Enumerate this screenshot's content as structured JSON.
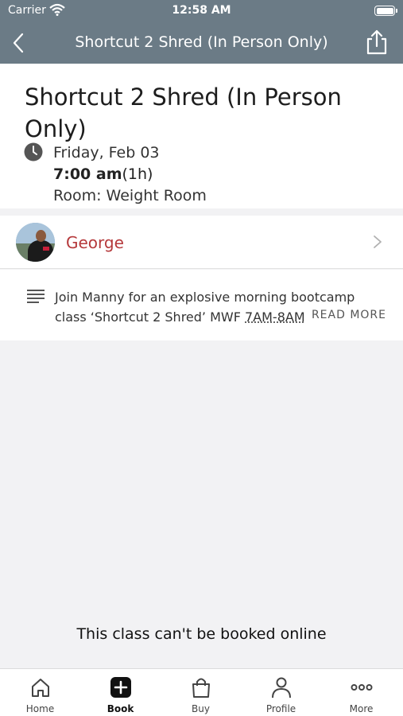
{
  "status_bar": {
    "carrier": "Carrier",
    "time": "12:58 AM"
  },
  "nav": {
    "title": "Shortcut 2 Shred (In Person Only)",
    "back_icon": "chevron-left-icon",
    "share_icon": "share-icon"
  },
  "class": {
    "title": "Shortcut 2 Shred (In Person Only)",
    "date": "Friday, Feb 03",
    "start_time": "7:00 am",
    "duration": "(1h)",
    "room": "Room: Weight Room"
  },
  "instructor": {
    "name": "George"
  },
  "description": {
    "text": "Join Manny for an explosive morning bootcamp class ‘Shortcut 2 Shred’ MWF ",
    "hours": "7AM-8AM",
    "read_more": "READ MORE"
  },
  "notice": "This class can't be booked online",
  "tabs": [
    {
      "label": "Home",
      "icon": "home-icon"
    },
    {
      "label": "Book",
      "icon": "add-icon"
    },
    {
      "label": "Buy",
      "icon": "shopping-bag-icon"
    },
    {
      "label": "Profile",
      "icon": "person-icon"
    },
    {
      "label": "More",
      "icon": "more-icon"
    }
  ],
  "colors": {
    "header": "#6b7b86",
    "instructor_name": "#b5393b",
    "background": "#f2f2f4"
  }
}
